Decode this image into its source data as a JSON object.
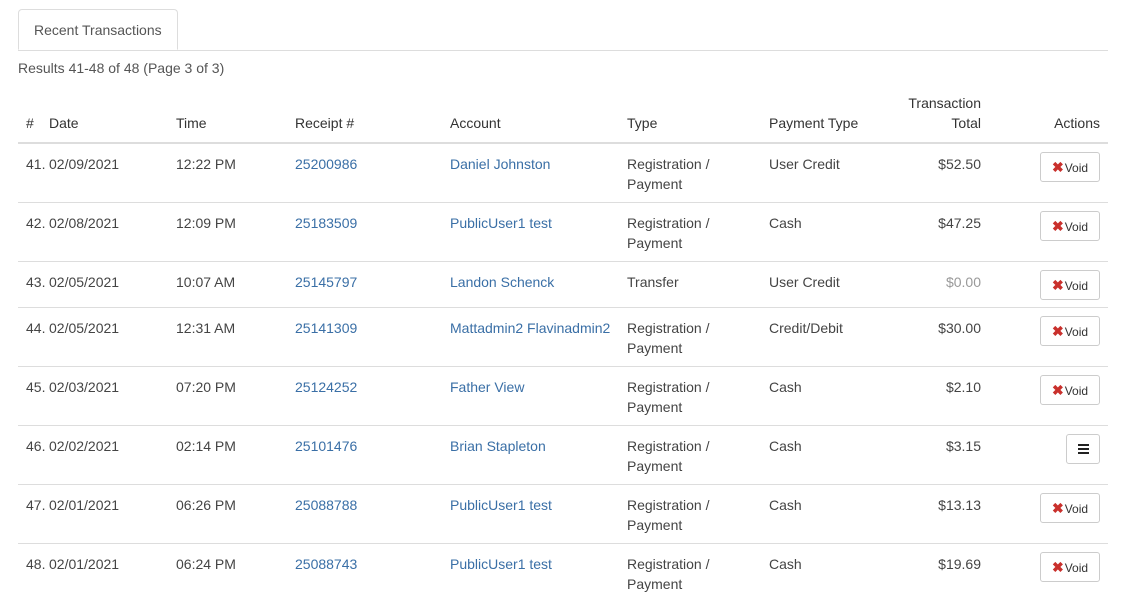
{
  "tabs": [
    {
      "label": "Recent Transactions"
    }
  ],
  "results_text": "Results 41-48 of 48 (Page 3 of 3)",
  "columns": {
    "num": "#",
    "date": "Date",
    "time": "Time",
    "receipt": "Receipt #",
    "account": "Account",
    "type": "Type",
    "payment_type": "Payment Type",
    "total_line1": "Transaction",
    "total_line2": "Total",
    "actions": "Actions"
  },
  "void_label": "Void",
  "rows": [
    {
      "num": "41.",
      "date": "02/09/2021",
      "time": "12:22 PM",
      "receipt": "25200986",
      "account": "Daniel Johnston",
      "type1": "Registration /",
      "type2": "Payment",
      "payment_type": "User Credit",
      "total": "$52.50",
      "action": "void"
    },
    {
      "num": "42.",
      "date": "02/08/2021",
      "time": "12:09 PM",
      "receipt": "25183509",
      "account": "PublicUser1 test",
      "type1": "Registration /",
      "type2": "Payment",
      "payment_type": "Cash",
      "total": "$47.25",
      "action": "void"
    },
    {
      "num": "43.",
      "date": "02/05/2021",
      "time": "10:07 AM",
      "receipt": "25145797",
      "account": "Landon Schenck",
      "type1": "Transfer",
      "type2": "",
      "payment_type": "User Credit",
      "total": "$0.00",
      "action": "void"
    },
    {
      "num": "44.",
      "date": "02/05/2021",
      "time": "12:31 AM",
      "receipt": "25141309",
      "account": "Mattadmin2 Flavinadmin2",
      "type1": "Registration /",
      "type2": "Payment",
      "payment_type": "Credit/Debit",
      "total": "$30.00",
      "action": "void"
    },
    {
      "num": "45.",
      "date": "02/03/2021",
      "time": "07:20 PM",
      "receipt": "25124252",
      "account": "Father View",
      "type1": "Registration /",
      "type2": "Payment",
      "payment_type": "Cash",
      "total": "$2.10",
      "action": "void"
    },
    {
      "num": "46.",
      "date": "02/02/2021",
      "time": "02:14 PM",
      "receipt": "25101476",
      "account": "Brian Stapleton",
      "type1": "Registration /",
      "type2": "Payment",
      "payment_type": "Cash",
      "total": "$3.15",
      "action": "menu"
    },
    {
      "num": "47.",
      "date": "02/01/2021",
      "time": "06:26 PM",
      "receipt": "25088788",
      "account": "PublicUser1 test",
      "type1": "Registration /",
      "type2": "Payment",
      "payment_type": "Cash",
      "total": "$13.13",
      "action": "void"
    },
    {
      "num": "48.",
      "date": "02/01/2021",
      "time": "06:24 PM",
      "receipt": "25088743",
      "account": "PublicUser1 test",
      "type1": "Registration /",
      "type2": "Payment",
      "payment_type": "Cash",
      "total": "$19.69",
      "action": "void"
    }
  ],
  "colors": {
    "link": "#3a6fa6",
    "void_x": "#c9302c",
    "border": "#dddddd"
  },
  "icons": {
    "void": "x-icon",
    "menu": "hamburger-menu-icon"
  }
}
